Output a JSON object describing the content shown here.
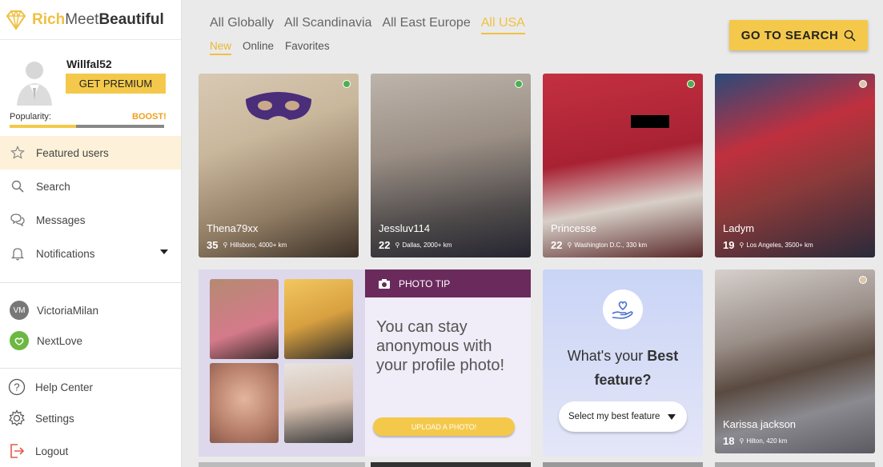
{
  "brand": {
    "part1": "Rich",
    "part2": "Meet",
    "part3": "Beautiful"
  },
  "profile": {
    "username": "Willfal52",
    "premium_label": "GET PREMIUM",
    "popularity_label": "Popularity:",
    "boost_label": "BOOST!",
    "popularity_level": 0.43
  },
  "menu": [
    {
      "label": "Featured users",
      "icon": "star-icon"
    },
    {
      "label": "Search",
      "icon": "search-icon"
    },
    {
      "label": "Messages",
      "icon": "messages-icon"
    },
    {
      "label": "Notifications",
      "icon": "bell-icon"
    }
  ],
  "external": [
    {
      "label": "VictoriaMilan",
      "badge": "VM"
    },
    {
      "label": "NextLove"
    }
  ],
  "bottom": [
    {
      "label": "Help Center",
      "icon": "help-icon"
    },
    {
      "label": "Settings",
      "icon": "gear-icon"
    },
    {
      "label": "Logout",
      "icon": "logout-icon"
    }
  ],
  "regions": [
    "All Globally",
    "All Scandinavia",
    "All East Europe",
    "All USA"
  ],
  "subtabs": [
    "New",
    "Online",
    "Favorites"
  ],
  "go_search": "GO TO SEARCH",
  "users": [
    {
      "name": "Thena79xx",
      "age": "35",
      "location": "Hillsboro, 4000+ km",
      "status_color": "#4caf50"
    },
    {
      "name": "Jessluv114",
      "age": "22",
      "location": "Dallas, 2000+ km",
      "status_color": "#4caf50"
    },
    {
      "name": "Princesse",
      "age": "22",
      "location": "Washington D.C., 330 km",
      "status_color": "#4caf50"
    },
    {
      "name": "Ladym",
      "age": "19",
      "location": "Los Angeles, 3500+ km",
      "status_color": "#d9c7a8"
    },
    {
      "name": "Karissa jackson",
      "age": "18",
      "location": "Hilton, 420 km",
      "status_color": "#d9c7a8"
    }
  ],
  "photo_tip": {
    "header": "PHOTO TIP",
    "text": "You can stay anonymous with your profile photo!",
    "button": "UPLOAD A PHOTO!"
  },
  "best_feature": {
    "question_start": "What's your ",
    "question_bold": "Best",
    "question_end": "feature?",
    "select": "Select my best feature"
  }
}
